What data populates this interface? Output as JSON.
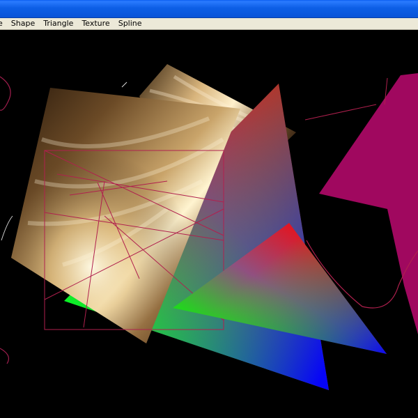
{
  "window": {
    "title": ""
  },
  "menu": {
    "items": [
      {
        "label": "e"
      },
      {
        "label": "Shape"
      },
      {
        "label": "Triangle"
      },
      {
        "label": "Texture"
      },
      {
        "label": "Spline"
      }
    ]
  },
  "colors": {
    "titlebar": "#0a5ef0",
    "menubar": "#ece9d8",
    "canvas_bg": "#000000",
    "magenta_shape": "#a0085f",
    "spline_line": "#a01e4e",
    "triangle_red": "#ff0000",
    "triangle_green": "#00ff00",
    "triangle_blue": "#0000ff"
  }
}
